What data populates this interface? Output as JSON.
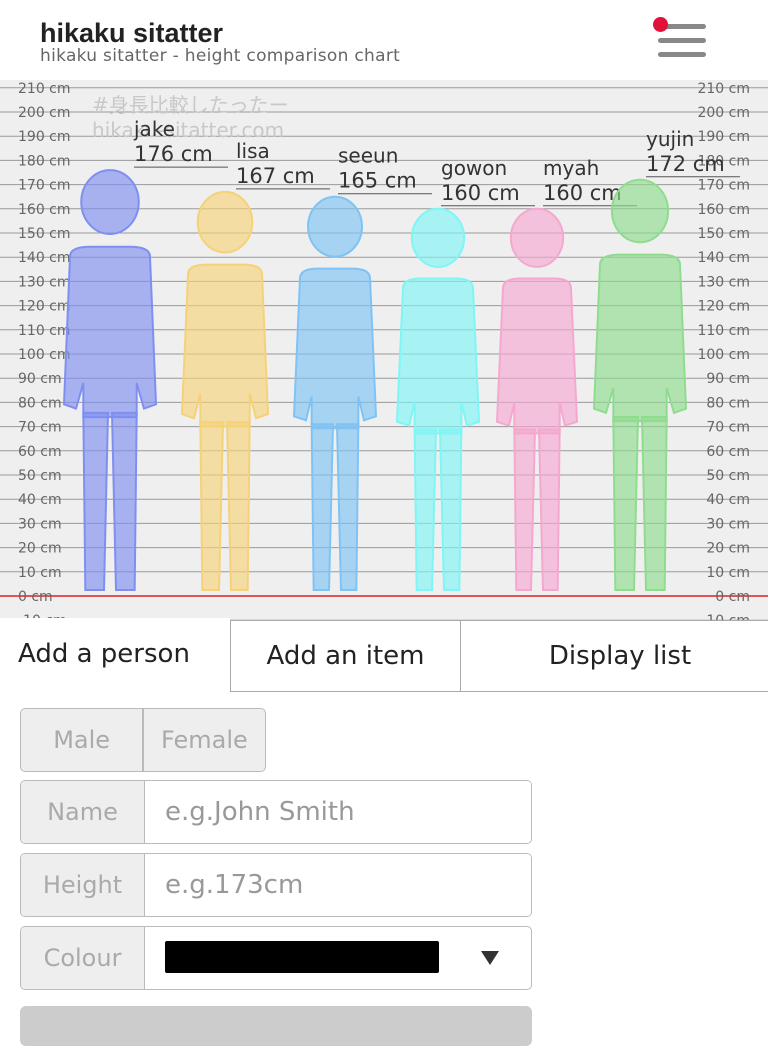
{
  "header": {
    "title": "hikaku sitatter",
    "subtitle": "hikaku sitatter - height comparison chart",
    "menu_icon": "hamburger-menu-icon",
    "notification_color": "#e0113b"
  },
  "chart": {
    "unit": "cm",
    "watermark_line1": "#身長比較したったー",
    "watermark_line2": "hikaku-sitatter.com",
    "people": [
      {
        "name": "jake",
        "height_label": "176 cm",
        "height": 176,
        "color": "#7f8ff0"
      },
      {
        "name": "lisa",
        "height_label": "167 cm",
        "height": 167,
        "color": "#f5d27a"
      },
      {
        "name": "seeun",
        "height_label": "165 cm",
        "height": 165,
        "color": "#7fc3f5"
      },
      {
        "name": "gowon",
        "height_label": "160 cm",
        "height": 160,
        "color": "#7ff5f5"
      },
      {
        "name": "myah",
        "height_label": "160 cm",
        "height": 160,
        "color": "#f5a8cf"
      },
      {
        "name": "yujin",
        "height_label": "172 cm",
        "height": 172,
        "color": "#8fdc8f"
      }
    ]
  },
  "tabs": {
    "person": "Add a person",
    "item": "Add an item",
    "list": "Display list"
  },
  "form": {
    "male": "Male",
    "female": "Female",
    "name_label": "Name",
    "name_placeholder": "e.g.John Smith",
    "height_label": "Height",
    "height_placeholder": "e.g.173cm",
    "colour_label": "Colour",
    "colour_value": "#000000",
    "dropdown_icon": "triangle-down-icon"
  }
}
